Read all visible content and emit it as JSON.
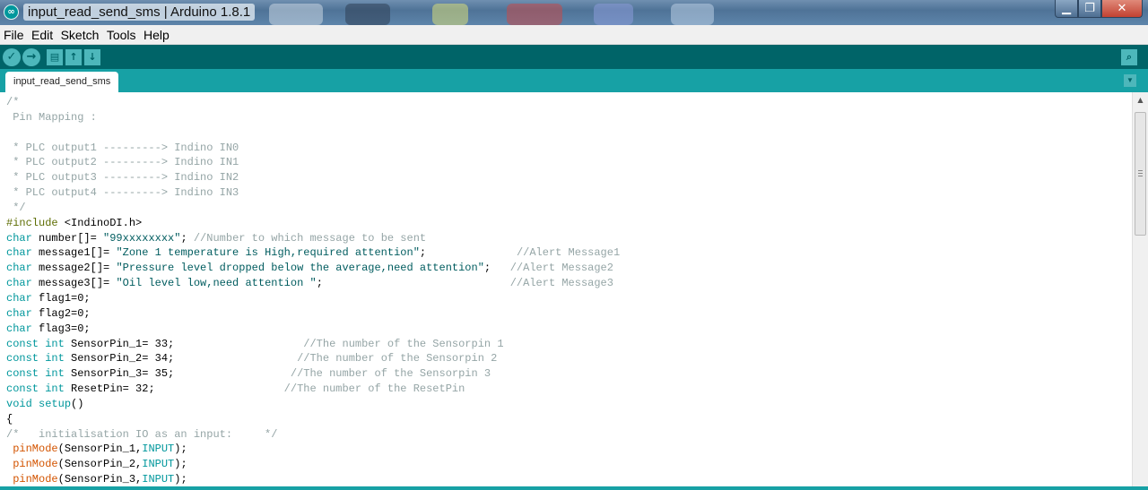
{
  "window": {
    "title": "input_read_send_sms | Arduino 1.8.1",
    "app_icon": "∞"
  },
  "window_buttons": {
    "minimize": "▁",
    "maximize": "❐",
    "close": "✕"
  },
  "menu": [
    "File",
    "Edit",
    "Sketch",
    "Tools",
    "Help"
  ],
  "toolbar": {
    "verify_icon": "✓",
    "upload_icon": "→",
    "new_icon": "▤",
    "open_icon": "↑",
    "save_icon": "↓",
    "serial_icon": "⌕"
  },
  "tabs": [
    {
      "label": "input_read_send_sms"
    }
  ],
  "tab_menu_icon": "▼",
  "scroll_up_icon": "▲",
  "colors": {
    "toolbar": "#006468",
    "tabstrip": "#17a1a5",
    "keyword": "#00979c",
    "comment": "#95a5a6",
    "function": "#d35400"
  },
  "code_lines": [
    [
      [
        "c",
        "/*"
      ]
    ],
    [
      [
        "c",
        " Pin Mapping :"
      ]
    ],
    [
      [
        "p",
        ""
      ]
    ],
    [
      [
        "c",
        " * PLC output1 ---------> Indino IN0"
      ]
    ],
    [
      [
        "c",
        " * PLC output2 ---------> Indino IN1"
      ]
    ],
    [
      [
        "c",
        " * PLC output3 ---------> Indino IN2"
      ]
    ],
    [
      [
        "c",
        " * PLC output4 ---------> Indino IN3"
      ]
    ],
    [
      [
        "c",
        " */"
      ]
    ],
    [
      [
        "pp",
        "#include"
      ],
      [
        "p",
        " <IndinoDI.h>"
      ]
    ],
    [
      [
        "k",
        "char"
      ],
      [
        "p",
        " number[]= "
      ],
      [
        "s",
        "\"99xxxxxxxx\""
      ],
      [
        "p",
        "; "
      ],
      [
        "c",
        "//Number to which message to be sent"
      ]
    ],
    [
      [
        "k",
        "char"
      ],
      [
        "p",
        " message1[]= "
      ],
      [
        "s",
        "\"Zone 1 temperature is High,required attention\""
      ],
      [
        "p",
        ";              "
      ],
      [
        "c",
        "//Alert Message1"
      ]
    ],
    [
      [
        "k",
        "char"
      ],
      [
        "p",
        " message2[]= "
      ],
      [
        "s",
        "\"Pressure level dropped below the average,need attention\""
      ],
      [
        "p",
        ";   "
      ],
      [
        "c",
        "//Alert Message2"
      ]
    ],
    [
      [
        "k",
        "char"
      ],
      [
        "p",
        " message3[]= "
      ],
      [
        "s",
        "\"Oil level low,need attention \""
      ],
      [
        "p",
        ";                             "
      ],
      [
        "c",
        "//Alert Message3"
      ]
    ],
    [
      [
        "k",
        "char"
      ],
      [
        "p",
        " flag1=0;"
      ]
    ],
    [
      [
        "k",
        "char"
      ],
      [
        "p",
        " flag2=0;"
      ]
    ],
    [
      [
        "k",
        "char"
      ],
      [
        "p",
        " flag3=0;"
      ]
    ],
    [
      [
        "k",
        "const"
      ],
      [
        "p",
        " "
      ],
      [
        "k",
        "int"
      ],
      [
        "p",
        " SensorPin_1= 33;                    "
      ],
      [
        "c",
        "//The number of the Sensorpin 1"
      ]
    ],
    [
      [
        "k",
        "const"
      ],
      [
        "p",
        " "
      ],
      [
        "k",
        "int"
      ],
      [
        "p",
        " SensorPin_2= 34;                   "
      ],
      [
        "c",
        "//The number of the Sensorpin 2"
      ]
    ],
    [
      [
        "k",
        "const"
      ],
      [
        "p",
        " "
      ],
      [
        "k",
        "int"
      ],
      [
        "p",
        " SensorPin_3= 35;                  "
      ],
      [
        "c",
        "//The number of the Sensorpin 3"
      ]
    ],
    [
      [
        "k",
        "const"
      ],
      [
        "p",
        " "
      ],
      [
        "k",
        "int"
      ],
      [
        "p",
        " ResetPin= 32;                    "
      ],
      [
        "c",
        "//The number of the ResetPin"
      ]
    ],
    [
      [
        "k",
        "void"
      ],
      [
        "p",
        " "
      ],
      [
        "k",
        "setup"
      ],
      [
        "p",
        "()"
      ]
    ],
    [
      [
        "p",
        "{"
      ]
    ],
    [
      [
        "c",
        "/*   initialisation IO as an input:     */"
      ]
    ],
    [
      [
        "p",
        " "
      ],
      [
        "f",
        "pinMode"
      ],
      [
        "p",
        "(SensorPin_1,"
      ],
      [
        "n",
        "INPUT"
      ],
      [
        "p",
        ");"
      ]
    ],
    [
      [
        "p",
        " "
      ],
      [
        "f",
        "pinMode"
      ],
      [
        "p",
        "(SensorPin_2,"
      ],
      [
        "n",
        "INPUT"
      ],
      [
        "p",
        ");"
      ]
    ],
    [
      [
        "p",
        " "
      ],
      [
        "f",
        "pinMode"
      ],
      [
        "p",
        "(SensorPin_3,"
      ],
      [
        "n",
        "INPUT"
      ],
      [
        "p",
        ");"
      ]
    ]
  ]
}
